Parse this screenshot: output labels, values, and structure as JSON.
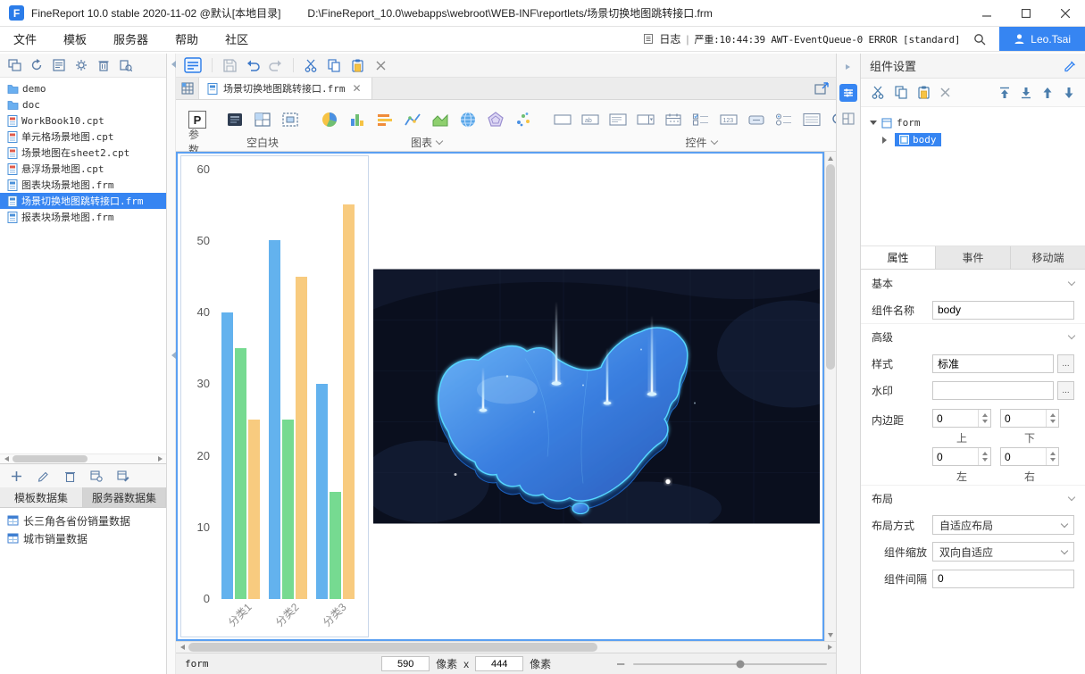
{
  "colors": {
    "accent": "#3685F2",
    "canvas_selection": "#5BA0F2"
  },
  "titlebar": {
    "app_title": "FineReport 10.0 stable 2020-11-02 @默认[本地目录]",
    "file_path": "D:\\FineReport_10.0\\webapps\\webroot\\WEB-INF\\reportlets/场景切换地图跳转接口.frm"
  },
  "menubar": {
    "items": [
      "文件",
      "模板",
      "服务器",
      "帮助",
      "社区"
    ],
    "log_label": "日志",
    "log_divider": "|",
    "log_message": "严重:10:44:39 AWT-EventQueue-0 ERROR [standard]",
    "user": "Leo.Tsai"
  },
  "left_panel": {
    "tree": [
      {
        "label": "demo",
        "type": "folder"
      },
      {
        "label": "doc",
        "type": "folder"
      },
      {
        "label": "WorkBook10.cpt",
        "type": "cpt"
      },
      {
        "label": "单元格场景地图.cpt",
        "type": "cpt"
      },
      {
        "label": "场景地图在sheet2.cpt",
        "type": "cpt"
      },
      {
        "label": "悬浮场景地图.cpt",
        "type": "cpt"
      },
      {
        "label": "图表块场景地图.frm",
        "type": "frm"
      },
      {
        "label": "场景切换地图跳转接口.frm",
        "type": "frm"
      },
      {
        "label": "报表块场景地图.frm",
        "type": "frm"
      }
    ],
    "dataset_tabs": [
      "模板数据集",
      "服务器数据集"
    ],
    "datasets": [
      "长三角各省份销量数据",
      "城市销量数据"
    ]
  },
  "editor": {
    "tab_title": "场景切换地图跳转接口.frm",
    "param_glyph": "P",
    "param_label": "参数",
    "groups": {
      "blank": "空白块",
      "chart": "图表",
      "widget": "控件"
    },
    "status": {
      "name": "form",
      "width": "590",
      "px": "像素",
      "times": "x",
      "height": "444",
      "zoom_out": "–"
    }
  },
  "chart_data": {
    "type": "bar",
    "title": "",
    "categories": [
      "分类1",
      "分类2",
      "分类3"
    ],
    "series": [
      {
        "color": "#63B2EE",
        "values": [
          40,
          50,
          30
        ]
      },
      {
        "color": "#76DA91",
        "values": [
          35,
          25,
          15
        ]
      },
      {
        "color": "#F8CB7F",
        "values": [
          25,
          45,
          55
        ]
      }
    ],
    "ylim": [
      0,
      60
    ],
    "yticks": [
      0,
      10,
      20,
      30,
      40,
      50,
      60
    ],
    "grid": false,
    "legend": "none"
  },
  "right_panel": {
    "title": "组件设置",
    "tree": {
      "root": "form",
      "child": "body"
    },
    "tabs": [
      "属性",
      "事件",
      "移动端"
    ],
    "basic": {
      "title": "基本",
      "name_label": "组件名称",
      "name_value": "body"
    },
    "advanced": {
      "title": "高级",
      "style_label": "样式",
      "style_value": "标准",
      "watermark_label": "水印",
      "watermark_value": "",
      "ellipsis": "...",
      "padding_label": "内边距",
      "pad_top": "0",
      "pad_bottom": "0",
      "pad_left": "0",
      "pad_right": "0",
      "label_top": "上",
      "label_bottom": "下",
      "label_left": "左",
      "label_right": "右"
    },
    "layout": {
      "title": "布局",
      "mode_label": "布局方式",
      "mode_value": "自适应布局",
      "scale_label": "组件缩放",
      "scale_value": "双向自适应",
      "gap_label": "组件间隔",
      "gap_value": "0"
    }
  }
}
